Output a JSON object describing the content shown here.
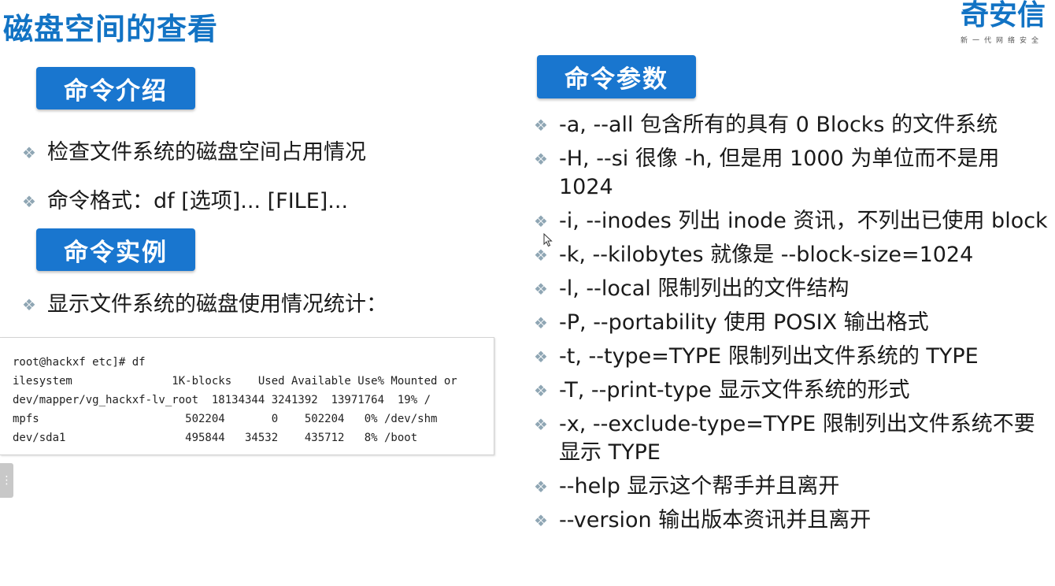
{
  "page": {
    "title": "磁盘空间的查看"
  },
  "logo": {
    "main_text": "奇安信",
    "sub_text": "新一代网络安全"
  },
  "left": {
    "section1_label": "命令介绍",
    "section2_label": "命令实例",
    "items": [
      "检查文件系统的磁盘空间占用情况",
      "命令格式：df [选项]... [FILE]..."
    ],
    "example_items": [
      "显示文件系统的磁盘使用情况统计："
    ]
  },
  "terminal": {
    "lines": [
      "root@hackxf etc]# df",
      "ilesystem               1K-blocks    Used Available Use% Mounted or",
      "dev/mapper/vg_hackxf-lv_root  18134344 3241392  13971764  19% /",
      "mpfs                      502204       0    502204   0% /dev/shm",
      "dev/sda1                  495844   34532    435712   8% /boot"
    ]
  },
  "right": {
    "section_label": "命令参数",
    "items": [
      "-a, --all 包含所有的具有 0 Blocks 的文件系统",
      "-H, --si 很像 -h, 但是用 1000 为单位而不是用 1024",
      "-i, --inodes 列出 inode 资讯，不列出已使用 block",
      "-k, --kilobytes 就像是 --block-size=1024",
      "-l, --local 限制列出的文件结构",
      "-P, --portability 使用 POSIX 输出格式",
      "-t, --type=TYPE 限制列出文件系统的 TYPE",
      "-T, --print-type 显示文件系统的形式",
      "-x, --exclude-type=TYPE 限制列出文件系统不要显示 TYPE",
      "--help 显示这个帮手并且离开",
      "--version 输出版本资讯并且离开"
    ]
  },
  "colors": {
    "accent": "#1976cf",
    "title": "#1273c4",
    "bullet": "#8fa6b4"
  }
}
